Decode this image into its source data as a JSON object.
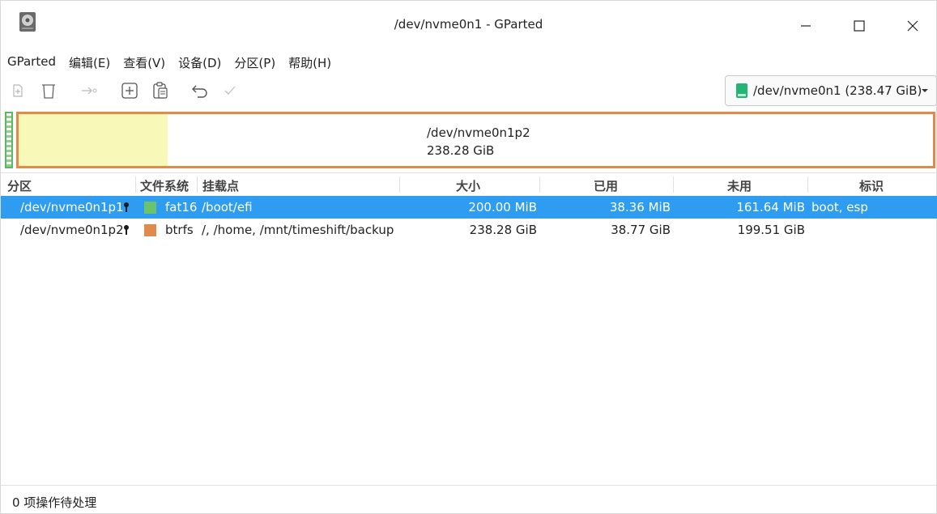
{
  "window": {
    "title": "/dev/nvme0n1 - GParted"
  },
  "menu": [
    "GParted",
    "编辑(E)",
    "查看(V)",
    "设备(D)",
    "分区(P)",
    "帮助(H)"
  ],
  "toolbar": {
    "icons": [
      "new-partition-icon",
      "delete-icon",
      "resize-move-icon",
      "copy-icon",
      "paste-icon",
      "undo-icon",
      "apply-icon"
    ],
    "device_label": "/dev/nvme0n1 (238.47 GiB)"
  },
  "diskmap": {
    "selected_name": "/dev/nvme0n1p2",
    "selected_size": "238.28 GiB",
    "used_fraction": 0.163
  },
  "table": {
    "headers": {
      "partition": "分区",
      "filesystem": "文件系统",
      "mountpoint": "挂载点",
      "size": "大小",
      "used": "已用",
      "unused": "未用",
      "flags": "标识"
    },
    "rows": [
      {
        "partition": "/dev/nvme0n1p1",
        "filesystem": "fat16",
        "fs_color": "#6bc46b",
        "mountpoint": "/boot/efi",
        "size": "200.00 MiB",
        "used": "38.36 MiB",
        "unused": "161.64 MiB",
        "flags": "boot, esp",
        "selected": true
      },
      {
        "partition": "/dev/nvme0n1p2",
        "filesystem": "btrfs",
        "fs_color": "#e08b4c",
        "mountpoint": "/, /home, /mnt/timeshift/backup",
        "size": "238.28 GiB",
        "used": "38.77 GiB",
        "unused": "199.51 GiB",
        "flags": "",
        "selected": false
      }
    ]
  },
  "status": {
    "text": "0 项操作待处理"
  },
  "colors": {
    "selection": "#2e9cf0",
    "fat16": "#6bc46b",
    "btrfs": "#e08b4c",
    "used_space": "#f8f8b8"
  }
}
